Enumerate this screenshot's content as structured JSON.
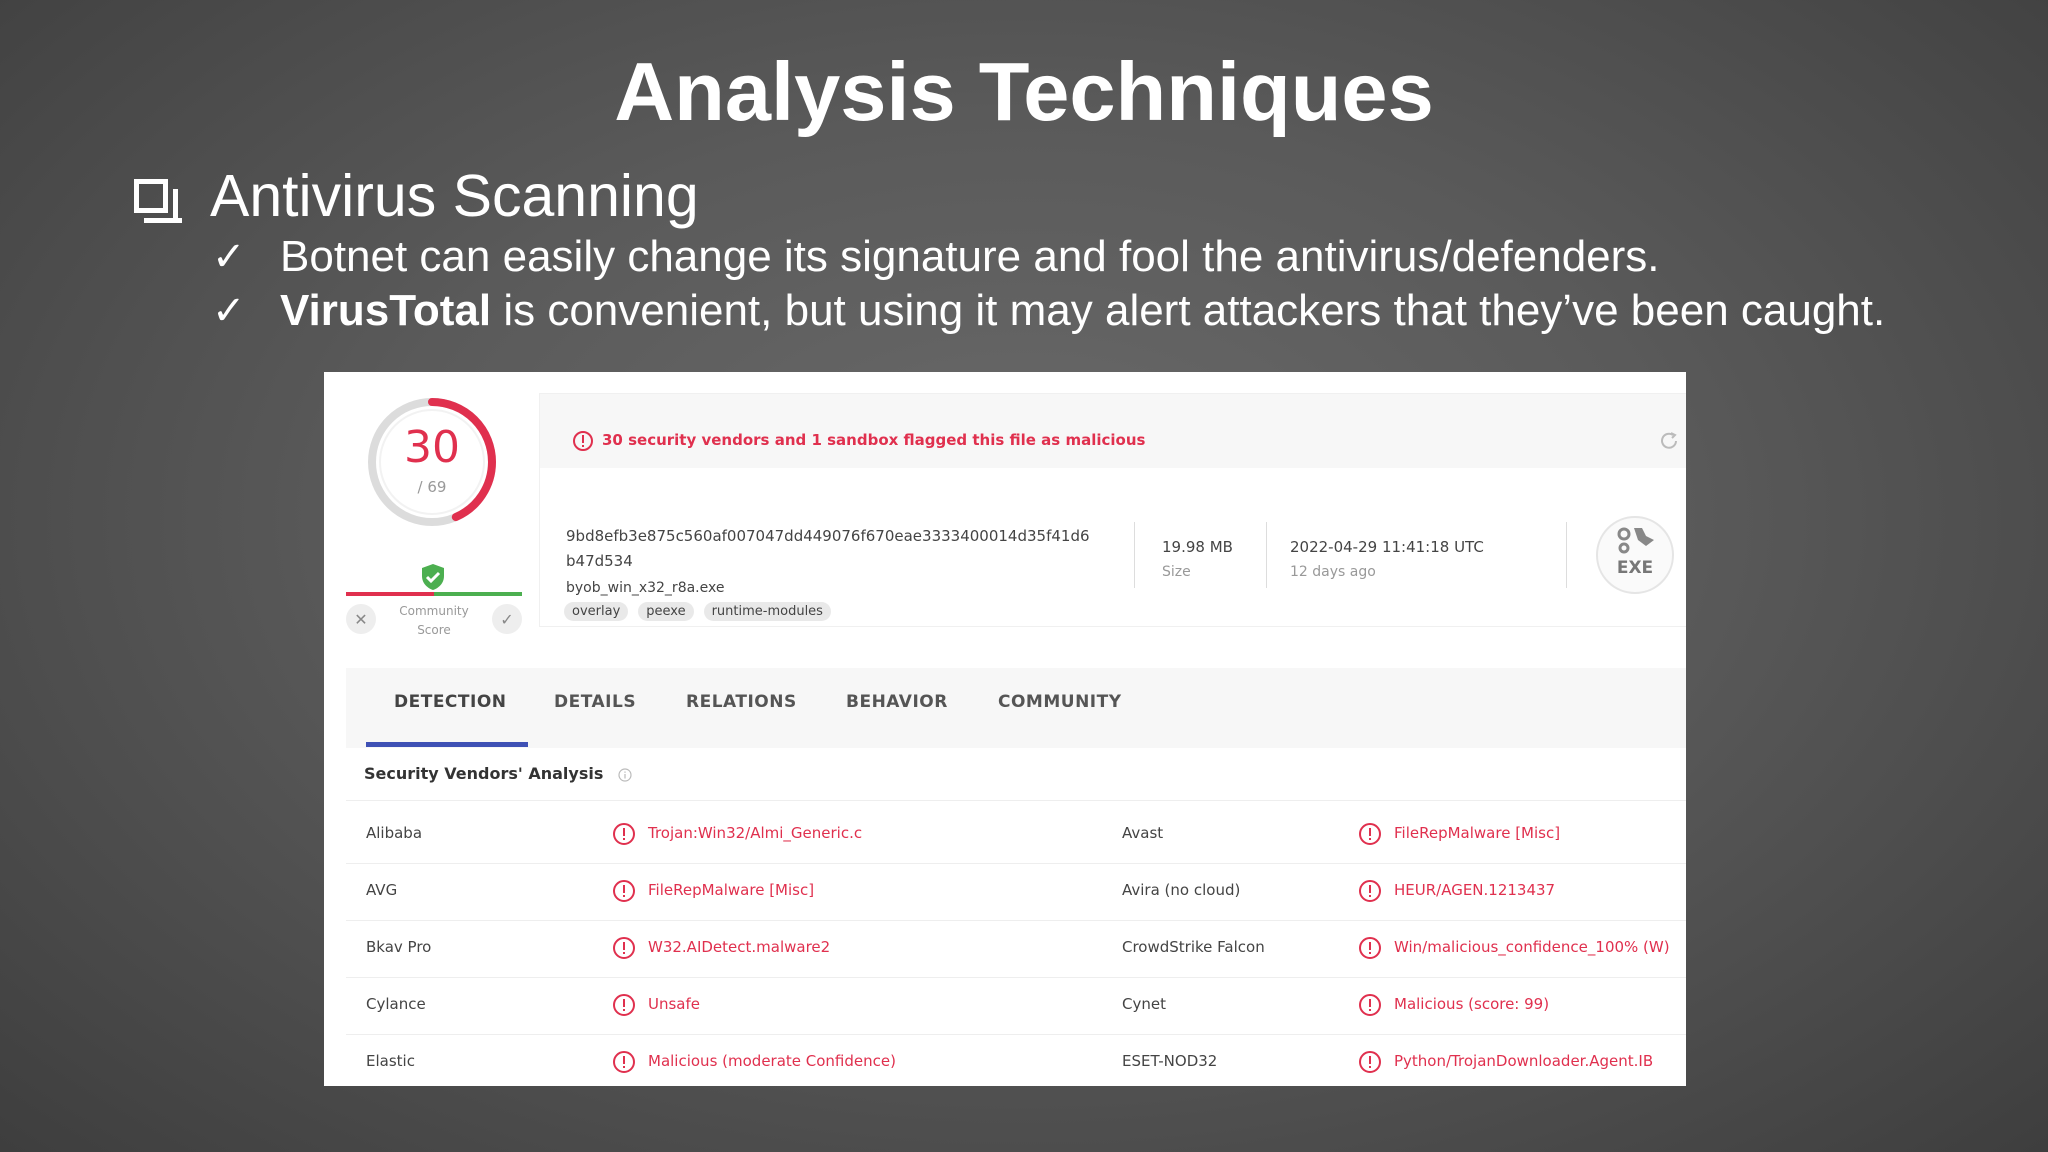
{
  "slide": {
    "title": "Analysis Techniques",
    "bullet1": "Antivirus Scanning",
    "sub1": "Botnet can easily change its signature and fool the antivirus/defenders.",
    "sub2_bold": "VirusTotal",
    "sub2_rest": " is convenient, but using it may alert attackers that they’ve been caught.",
    "check_glyph": "✓"
  },
  "virustotal": {
    "score": "30",
    "score_total": "/ 69",
    "detection_fraction": 0.4348,
    "community_label_1": "Community",
    "community_label_2": "Score",
    "alert": "30 security vendors and 1 sandbox flagged this file as malicious",
    "hash_line1": "9bd8efb3e875c560af007047dd449076f670eae3333400014d35f41d6",
    "hash_line2": "b47d534",
    "filename": "byob_win_x32_r8a.exe",
    "tags": [
      "overlay",
      "peexe",
      "runtime-modules"
    ],
    "size_value": "19.98 MB",
    "size_label": "Size",
    "date_value": "2022-04-29 11:41:18 UTC",
    "date_label": "12 days ago",
    "file_type": "EXE",
    "tabs": [
      "DETECTION",
      "DETAILS",
      "RELATIONS",
      "BEHAVIOR",
      "COMMUNITY"
    ],
    "active_tab": "DETECTION",
    "section_title": "Security Vendors' Analysis",
    "rows": [
      {
        "v1": "Alibaba",
        "r1": "Trojan:Win32/Almi_Generic.c",
        "v2": "Avast",
        "r2": "FileRepMalware [Misc]"
      },
      {
        "v1": "AVG",
        "r1": "FileRepMalware [Misc]",
        "v2": "Avira (no cloud)",
        "r2": "HEUR/AGEN.1213437"
      },
      {
        "v1": "Bkav Pro",
        "r1": "W32.AIDetect.malware2",
        "v2": "CrowdStrike Falcon",
        "r2": "Win/malicious_confidence_100% (W)"
      },
      {
        "v1": "Cylance",
        "r1": "Unsafe",
        "v2": "Cynet",
        "r2": "Malicious (score: 99)"
      },
      {
        "v1": "Elastic",
        "r1": "Malicious (moderate Confidence)",
        "v2": "ESET-NOD32",
        "r2": "Python/TrojanDownloader.Agent.IB"
      }
    ],
    "colors": {
      "malicious": "#e0304e",
      "accent": "#3f51b5",
      "harmless": "#4caf50"
    }
  }
}
